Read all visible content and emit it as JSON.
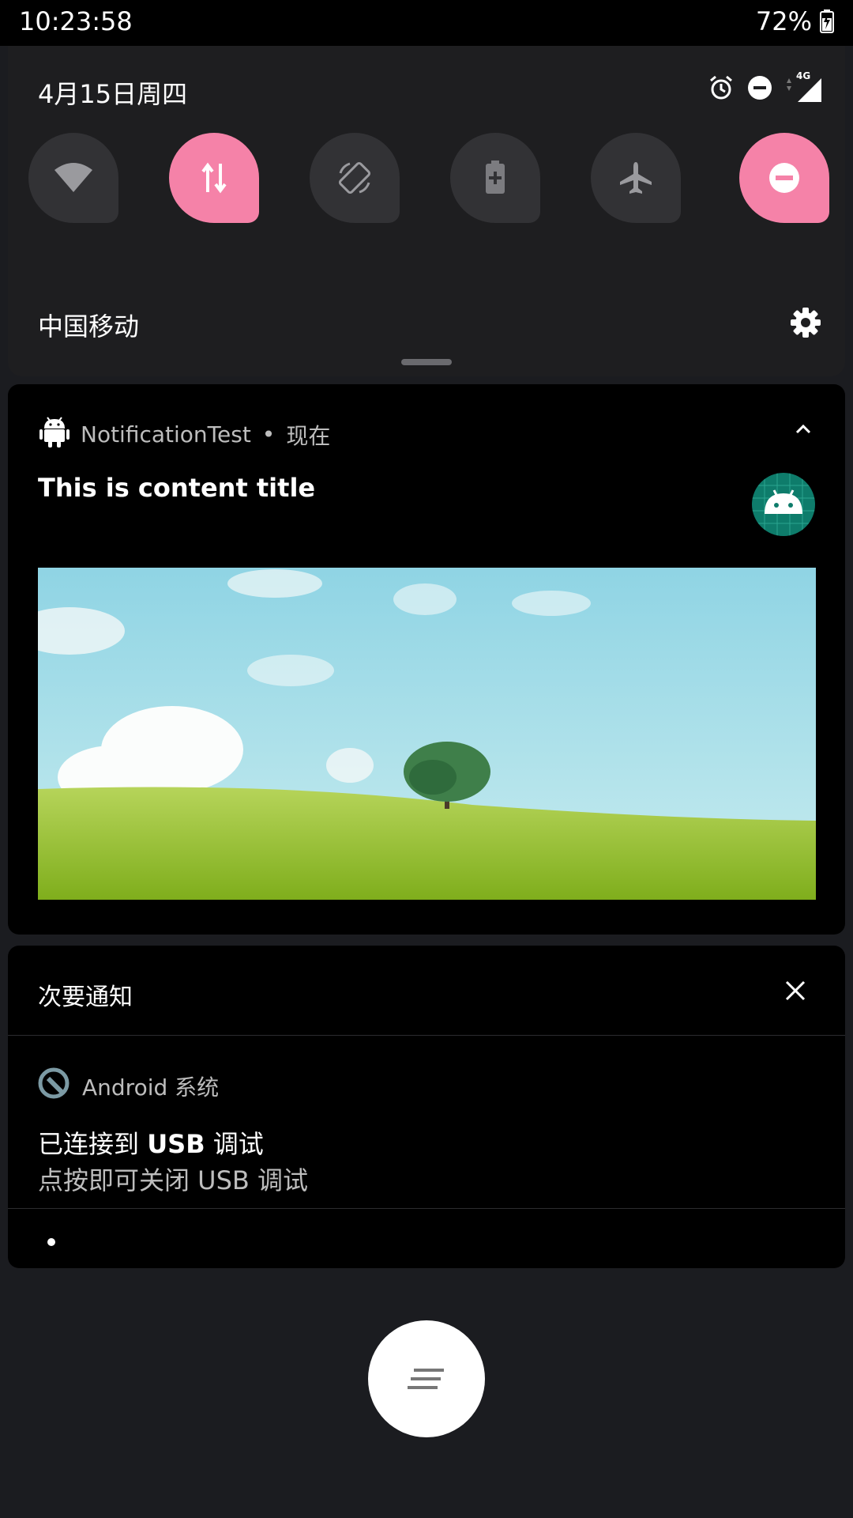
{
  "status_bar": {
    "time": "10:23:58",
    "battery": "72%"
  },
  "quick_settings": {
    "date": "4月15日周四",
    "network_badge": "4G",
    "tiles": [
      {
        "name": "wifi",
        "state": "off",
        "icon": "wifi-icon"
      },
      {
        "name": "mobile-data",
        "state": "on",
        "icon": "data-arrows-icon"
      },
      {
        "name": "auto-rotate",
        "state": "off",
        "icon": "rotate-icon"
      },
      {
        "name": "battery-saver",
        "state": "off",
        "icon": "battery-icon"
      },
      {
        "name": "airplane-mode",
        "state": "off",
        "icon": "airplane-icon"
      },
      {
        "name": "do-not-disturb",
        "state": "on",
        "icon": "minus-circle-icon"
      }
    ],
    "carrier": "中国移动"
  },
  "notification": {
    "app_name": "NotificationTest",
    "separator": "•",
    "time": "现在",
    "title": "This is content title"
  },
  "silent": {
    "header": "次要通知",
    "app_name": "Android 系统",
    "title_prefix": "已连接到 ",
    "title_bold": "USB",
    "title_suffix": " 调试",
    "text": "点按即可关闭 USB 调试"
  },
  "colors": {
    "accent": "#f582a8",
    "tile_off": "#323235",
    "icon_teal": "#0e7c6b"
  }
}
